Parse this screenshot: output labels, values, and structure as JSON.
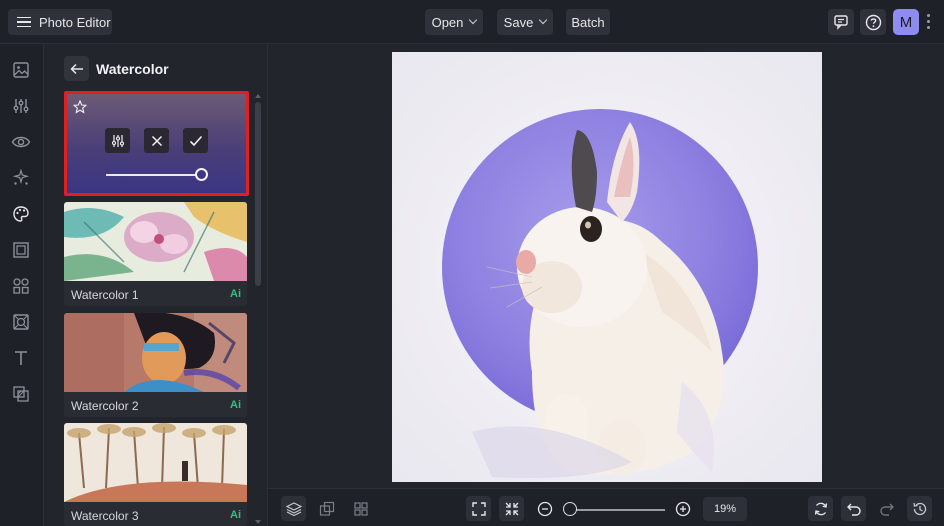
{
  "header": {
    "app_title": "Photo Editor",
    "open_label": "Open",
    "save_label": "Save",
    "batch_label": "Batch",
    "avatar_initial": "M"
  },
  "rail": {
    "items": [
      "image-icon",
      "adjust-icon",
      "eye-icon",
      "sparkle-icon",
      "palette-icon",
      "frame-icon",
      "shapes-icon",
      "texture-icon",
      "text-icon",
      "overlay-icon"
    ]
  },
  "panel": {
    "title": "Watercolor",
    "active_preset": {
      "intensity": 1.0
    },
    "effects": [
      {
        "label": "Watercolor 1",
        "badge": "Ai"
      },
      {
        "label": "Watercolor 2",
        "badge": "Ai"
      },
      {
        "label": "Watercolor 3",
        "badge": "Ai"
      }
    ]
  },
  "bottombar": {
    "zoom_label": "19%",
    "zoom_fraction": 0.0
  },
  "colors": {
    "accent": "#8f8cf0",
    "highlight_border": "#e02020",
    "ai_badge": "#2fc37a",
    "background": "#23252d"
  }
}
